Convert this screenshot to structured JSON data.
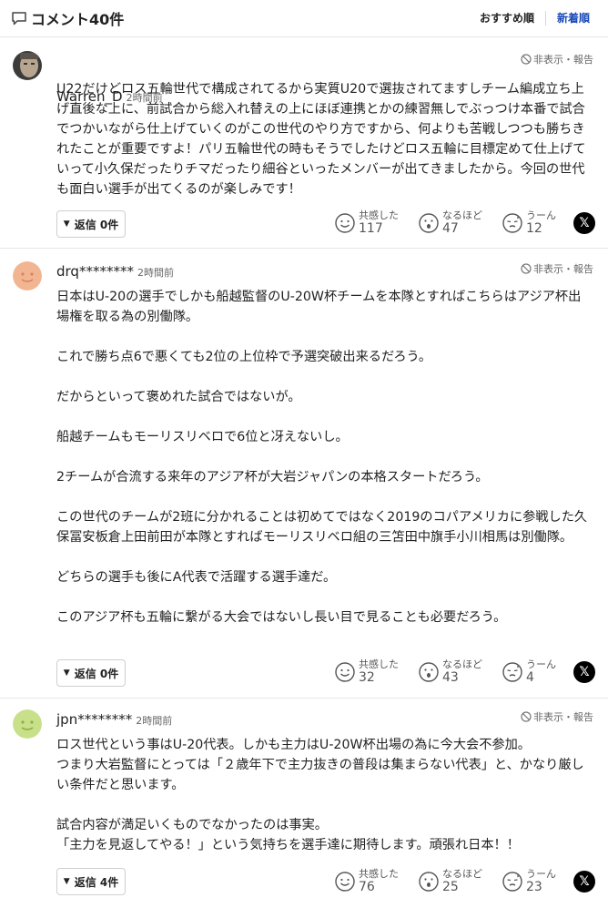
{
  "header": {
    "title": "コメント40件",
    "sort_recommended": "おすすめ順",
    "sort_newest": "新着順"
  },
  "labels": {
    "report": "非表示・報告",
    "empathy": "共感した",
    "insight": "なるほど",
    "hmm": "うーん"
  },
  "comments": [
    {
      "author": "Warren_D",
      "time": "2時間前",
      "paragraphs": [
        "U22だけどロス五輪世代で構成されてるから実質U20で選抜されてますしチーム編成立ち上げ直後な上に、前試合から総入れ替えの上にほぼ連携とかの練習無しでぶっつけ本番で試合でつかいながら仕上げていくのがこの世代のやり方ですから、何よりも苦戦しつつも勝ちきれたことが重要ですよ！パリ五輪世代の時もそうでしたけどロス五輪に目標定めて仕上げていって小久保だったりチマだったり細谷といったメンバーが出てきましたから。今回の世代も面白い選手が出てくるのが楽しみです！"
      ],
      "reply_label": "返信 0件",
      "empathy_count": "117",
      "insight_count": "47",
      "hmm_count": "12"
    },
    {
      "author": "drq********",
      "time": "2時間前",
      "paragraphs": [
        "日本はU-20の選手でしかも船越監督のU-20W杯チームを本隊とすればこちらはアジア杯出場権を取る為の別働隊。",
        "これで勝ち点6で悪くても2位の上位枠で予選突破出来るだろう。",
        "だからといって褒めれた試合ではないが。",
        "船越チームもモーリスリベロで6位と冴えないし。",
        "2チームが合流する来年のアジア杯が大岩ジャパンの本格スタートだろう。",
        "この世代のチームが2班に分かれることは初めてではなく2019のコパアメリカに参戦した久保冨安板倉上田前田が本隊とすればモーリスリベロ組の三笘田中旗手小川相馬は別働隊。",
        "どちらの選手も後にA代表で活躍する選手達だ。",
        "このアジア杯も五輪に繋がる大会ではないし長い目で見ることも必要だろう。"
      ],
      "reply_label": "返信 0件",
      "empathy_count": "32",
      "insight_count": "43",
      "hmm_count": "4"
    },
    {
      "author": "jpn********",
      "time": "2時間前",
      "paragraphs": [
        "ロス世代という事はU-20代表。しかも主力はU-20W杯出場の為に今大会不参加。\nつまり大岩監督にとっては「２歳年下で主力抜きの普段は集まらない代表」と、かなり厳しい条件だと思います。",
        "試合内容が満足いくものでなかったのは事実。\n「主力を見返してやる！」という気持ちを選手達に期待します。頑張れ日本！！"
      ],
      "reply_label": "返信 4件",
      "empathy_count": "76",
      "insight_count": "25",
      "hmm_count": "23"
    }
  ]
}
